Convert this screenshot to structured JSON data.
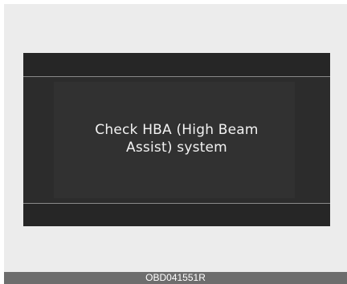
{
  "display": {
    "message_line1": "Check HBA (High Beam",
    "message_line2": "Assist) system"
  },
  "caption": {
    "code": "OBD041551R"
  },
  "colors": {
    "screen_background": "#1e1e1e",
    "message_text": "#f2f2f2",
    "caption_bar": "#6d6d6d",
    "panel_background": "#ececec"
  }
}
